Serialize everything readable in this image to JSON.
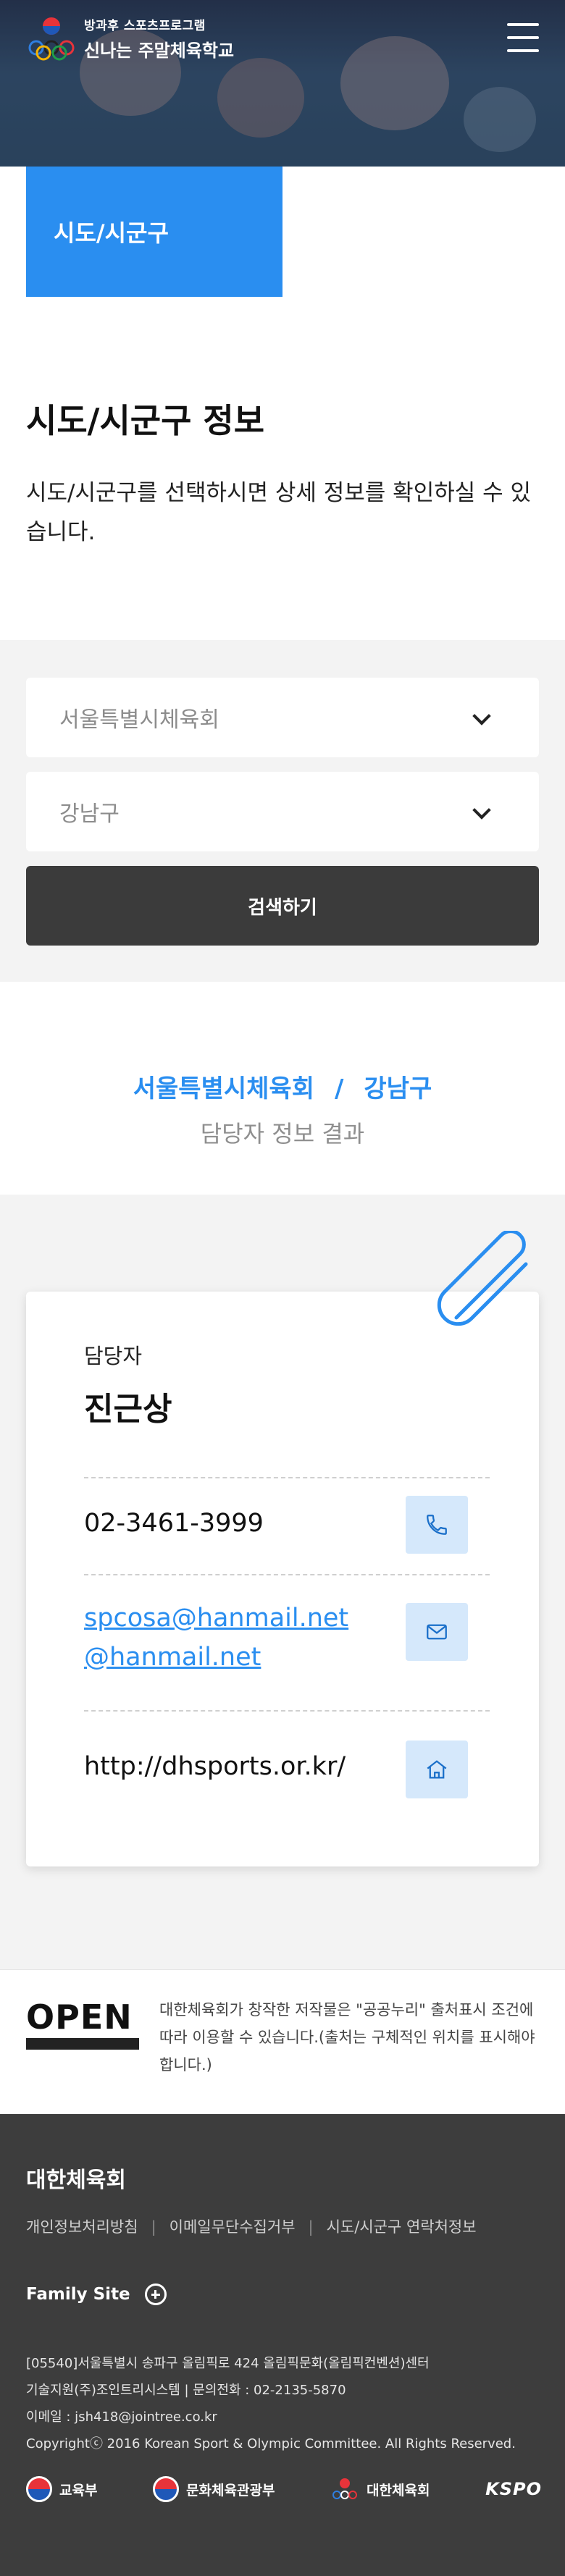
{
  "header": {
    "logo_subtitle": "방과후 스포츠프로그램",
    "logo_title": "신나는 주말체육학교",
    "menu_icon": "hamburger-menu-icon"
  },
  "section_tag": "시도/시군구",
  "page": {
    "title": "시도/시군구 정보",
    "description": "시도/시군구를 선택하시면 상세 정보를 확인하실 수 있습니다."
  },
  "search": {
    "select_sido": "서울특별시체육회",
    "select_sigungu": "강남구",
    "button_label": "검색하기"
  },
  "result": {
    "region": "서울특별시체육회",
    "separator": "/",
    "district": "강남구",
    "subtitle": "담당자 정보 결과"
  },
  "contact": {
    "label": "담당자",
    "name": "진근상",
    "phone": "02-3461-3999",
    "email_line1": "spcosa@hanmail.net",
    "email_line2": "@hanmail.net",
    "website": "http://dhsports.or.kr/"
  },
  "license": {
    "open_label": "OPEN",
    "text": "대한체육회가 창작한 저작물은 \"공공누리\" 출처표시 조건에 따라 이용할 수 있습니다.(출처는 구체적인 위치를 표시해야 합니다.)"
  },
  "footer": {
    "org_name": "대한체육회",
    "links": [
      "개인정보처리방침",
      "이메일무단수집거부",
      "시도/시군구 연락처정보"
    ],
    "family_site": "Family Site",
    "address_line1": "[05540]서울특별시 송파구 올림픽로 424 올림픽문화(올림픽컨벤션)센터",
    "address_line2": "기술지원(주)조인트리시스템 | 문의전화 : 02-2135-5870",
    "address_line3": "이메일 : jsh418@jointree.co.kr",
    "copyright": "Copyrightⓒ 2016 Korean Sport & Olympic Committee. All Rights Reserved.",
    "partner_logos": [
      "교육부",
      "문화체육관광부",
      "대한체육회",
      "KSPO"
    ]
  },
  "colors": {
    "accent_blue": "#2a8ef0",
    "dark_button": "#3b3b3b",
    "footer_bg": "#3d3d3d",
    "icon_bg": "#d5e8fb"
  }
}
